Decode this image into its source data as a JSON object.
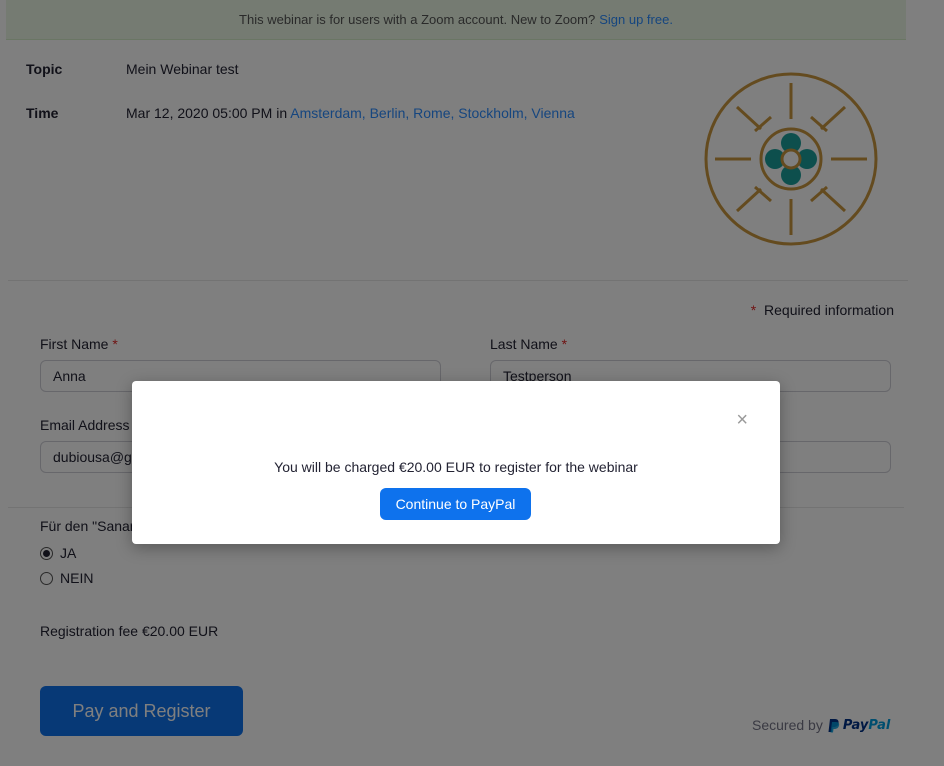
{
  "banner": {
    "text": "This webinar is for users with a Zoom account. New to Zoom?",
    "link": "Sign up free."
  },
  "webinar": {
    "topic_label": "Topic",
    "topic_value": "Mein Webinar test",
    "time_label": "Time",
    "time_value": "Mar 12, 2020 05:00 PM",
    "time_in": "in",
    "timezone": "Amsterdam, Berlin, Rome, Stockholm, Vienna"
  },
  "form": {
    "required_note": "Required information",
    "required_star": "*",
    "first_name_label": "First Name",
    "first_name_value": "Anna",
    "last_name_label": "Last Name",
    "last_name_value": "Testperson",
    "email_label": "Email Address",
    "email_value": "dubiousa@gr",
    "question": "Für den \"Sanan",
    "options": [
      "JA",
      "NEIN"
    ],
    "selected_option": "JA",
    "fee_text": "Registration fee €20.00  EUR",
    "pay_button": "Pay and Register",
    "secured_text": "Secured by",
    "paypal_pay": "Pay",
    "paypal_pal": "Pal"
  },
  "modal": {
    "close": "×",
    "message": "You will be charged €20.00  EUR to register for the webinar",
    "button": "Continue to PayPal"
  },
  "colors": {
    "accent": "#0e72ed",
    "link": "#2d8cff",
    "logo_gold": "#c9963f",
    "logo_teal": "#1a9e9a"
  }
}
